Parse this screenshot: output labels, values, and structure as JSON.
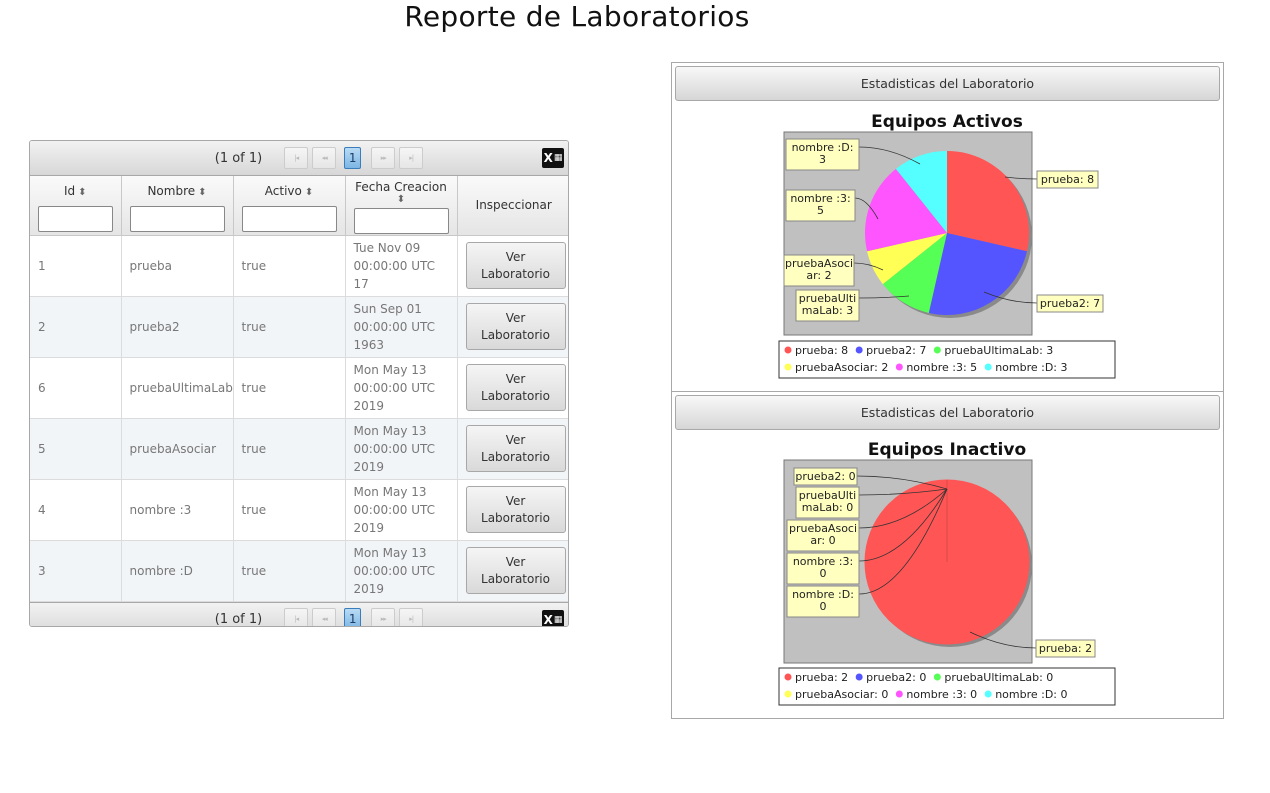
{
  "page": {
    "title": "Reporte de Laboratorios"
  },
  "table": {
    "paginator": {
      "report": "(1 of 1)",
      "current_page": "1",
      "first_icon": "first-page-icon",
      "prev_icon": "previous-page-icon",
      "next_icon": "next-page-icon",
      "last_icon": "last-page-icon",
      "export_icon": "excel-export-icon",
      "export_label": "X"
    },
    "columns": [
      {
        "label": "Id",
        "sortable": true,
        "filter": true
      },
      {
        "label": "Nombre",
        "sortable": true,
        "filter": true
      },
      {
        "label": "Activo",
        "sortable": true,
        "filter": true
      },
      {
        "label": "Fecha Creacion",
        "sortable": true,
        "filter": true
      },
      {
        "label": "Inspeccionar",
        "sortable": false,
        "filter": false
      }
    ],
    "sort_glyph": "⬍",
    "action_label_line1": "Ver",
    "action_label_line2": "Laboratorio",
    "rows": [
      {
        "id": "1",
        "nombre": "prueba",
        "activo": "true",
        "fecha_l1": "Tue Nov 09",
        "fecha_l2": "00:00:00 UTC 17",
        "fecha_l3": ""
      },
      {
        "id": "2",
        "nombre": "prueba2",
        "activo": "true",
        "fecha_l1": "Sun Sep 01",
        "fecha_l2": "00:00:00 UTC",
        "fecha_l3": "1963"
      },
      {
        "id": "6",
        "nombre": "pruebaUltimaLab",
        "activo": "true",
        "fecha_l1": "Mon May 13",
        "fecha_l2": "00:00:00 UTC",
        "fecha_l3": "2019"
      },
      {
        "id": "5",
        "nombre": "pruebaAsociar",
        "activo": "true",
        "fecha_l1": "Mon May 13",
        "fecha_l2": "00:00:00 UTC",
        "fecha_l3": "2019"
      },
      {
        "id": "4",
        "nombre": "nombre :3",
        "activo": "true",
        "fecha_l1": "Mon May 13",
        "fecha_l2": "00:00:00 UTC",
        "fecha_l3": "2019"
      },
      {
        "id": "3",
        "nombre": "nombre :D",
        "activo": "true",
        "fecha_l1": "Mon May 13",
        "fecha_l2": "00:00:00 UTC",
        "fecha_l3": "2019"
      }
    ]
  },
  "panels": [
    {
      "header": "Estadisticas del Laboratorio"
    },
    {
      "header": "Estadisticas del Laboratorio"
    }
  ],
  "chart_data": [
    {
      "type": "pie",
      "title": "Equipos Activos",
      "categories": [
        "prueba",
        "prueba2",
        "pruebaUltimaLab",
        "pruebaAsociar",
        "nombre :3",
        "nombre :D"
      ],
      "values": [
        8,
        7,
        3,
        2,
        5,
        3
      ],
      "colors": [
        "#ff5555",
        "#5555ff",
        "#55ff55",
        "#ffff55",
        "#ff55ff",
        "#55ffff"
      ],
      "callouts": [
        "prueba: 8",
        "prueba2: 7",
        "pruebaUlti|maLab: 3",
        "pruebaAsoci|ar: 2",
        "nombre :3:|5",
        "nombre :D:|3"
      ],
      "legend": [
        "prueba: 8",
        "prueba2: 7",
        "pruebaUltimaLab: 3",
        "pruebaAsociar: 2",
        "nombre :3: 5",
        "nombre :D: 3"
      ],
      "legend_placement": "bottom"
    },
    {
      "type": "pie",
      "title": "Equipos Inactivo",
      "categories": [
        "prueba",
        "prueba2",
        "pruebaUltimaLab",
        "pruebaAsociar",
        "nombre :3",
        "nombre :D"
      ],
      "values": [
        2,
        0,
        0,
        0,
        0,
        0
      ],
      "colors": [
        "#ff5555",
        "#5555ff",
        "#55ff55",
        "#ffff55",
        "#ff55ff",
        "#55ffff"
      ],
      "callouts": [
        "prueba: 2",
        "prueba2: 0",
        "pruebaUlti|maLab: 0",
        "pruebaAsoci|ar: 0",
        "nombre :3:|0",
        "nombre :D:|0"
      ],
      "legend": [
        "prueba: 2",
        "prueba2: 0",
        "pruebaUltimaLab: 0",
        "pruebaAsociar: 0",
        "nombre :3: 0",
        "nombre :D: 0"
      ],
      "legend_placement": "bottom"
    }
  ]
}
